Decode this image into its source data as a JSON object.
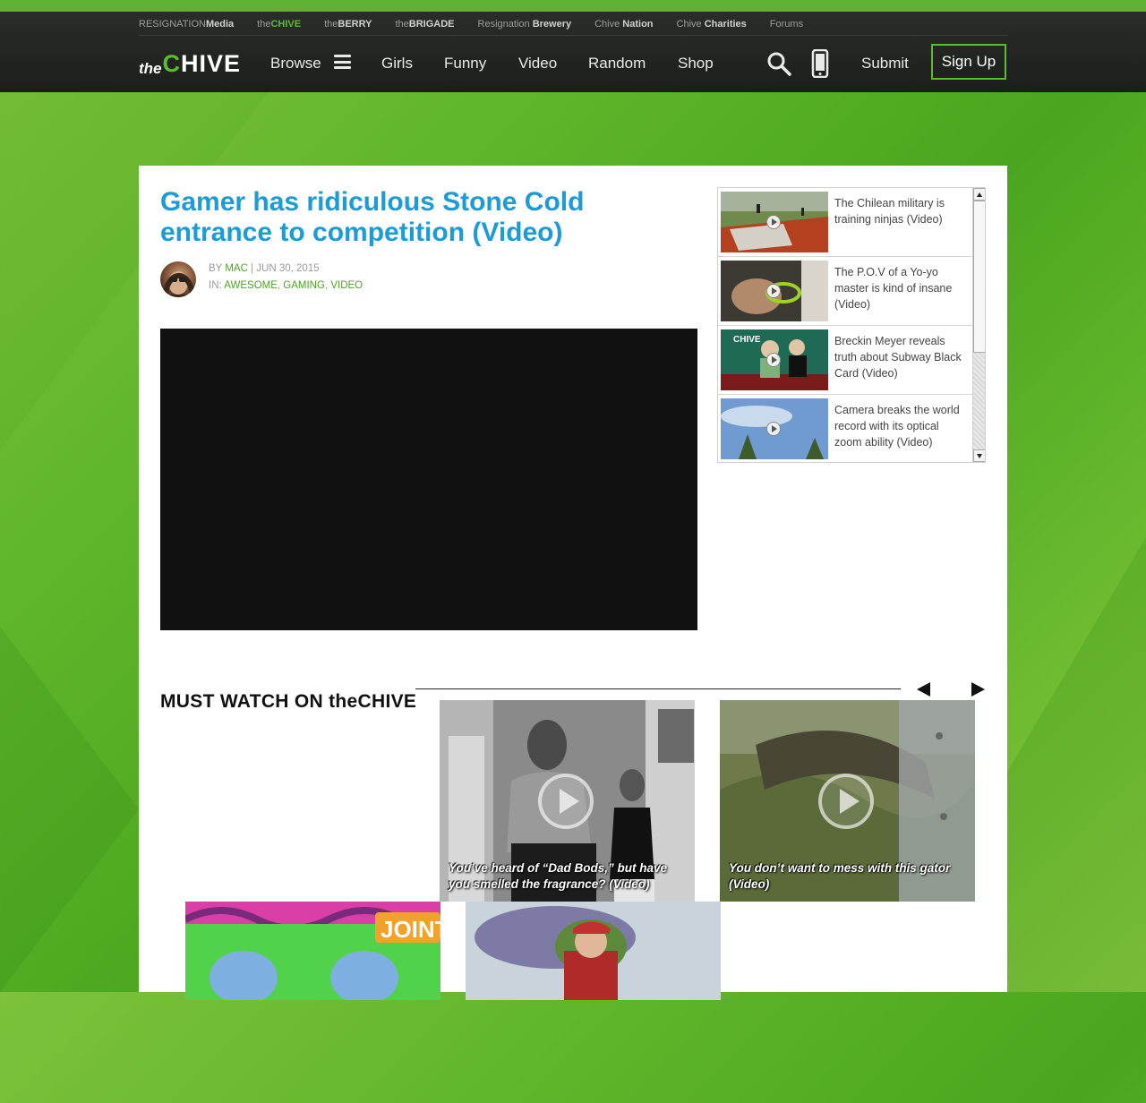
{
  "colors": {
    "brand_green": "#5dbb2f",
    "title_blue": "#1c9bd6",
    "header_bg": "#222522"
  },
  "network": [
    {
      "pre": "RESIGNATION",
      "bold": "Media"
    },
    {
      "pre": "the",
      "bold": "CHIVE",
      "active": true
    },
    {
      "pre": "the",
      "bold": "BERRY"
    },
    {
      "pre": "the",
      "bold": "BRIGADE"
    },
    {
      "pre": "Resignation ",
      "bold": "Brewery"
    },
    {
      "pre": "Chive ",
      "bold": "Nation"
    },
    {
      "pre": "Chive ",
      "bold": "Charities"
    },
    {
      "pre": "Forums",
      "bold": ""
    }
  ],
  "logo": {
    "the": "the",
    "c": "C",
    "rest": "HIVE"
  },
  "nav": {
    "browse": "Browse",
    "girls": "Girls",
    "funny": "Funny",
    "video": "Video",
    "random": "Random",
    "shop": "Shop",
    "submit": "Submit",
    "signup": "Sign Up"
  },
  "article": {
    "title": "Gamer has ridiculous Stone Cold entrance to competition (Video)",
    "by_label": "BY ",
    "author": "MAC",
    "date": " | JUN 30, 2015",
    "in_label": "IN: ",
    "categories": [
      "AWESOME",
      "GAMING",
      "VIDEO"
    ]
  },
  "sidebar_videos": [
    {
      "title": "The Chilean military is training ninjas (Video)"
    },
    {
      "title": "The P.O.V of a Yo-yo master is kind of insane (Video)"
    },
    {
      "title": "Breckin Meyer reveals truth about Subway Black Card (Video)"
    },
    {
      "title": "Camera breaks the world record with its optical zoom ability (Video)"
    }
  ],
  "must_watch": {
    "heading": "MUST WATCH ON theCHIVE",
    "cards": [
      {
        "caption": "You’ve heard of “Dad Bods,” but have you smelled the fragrance? (Video)"
      },
      {
        "caption": "You don’t want to mess with this gator (Video)"
      },
      {
        "caption": "",
        "sign": "JOINT"
      },
      {
        "caption": ""
      }
    ]
  }
}
